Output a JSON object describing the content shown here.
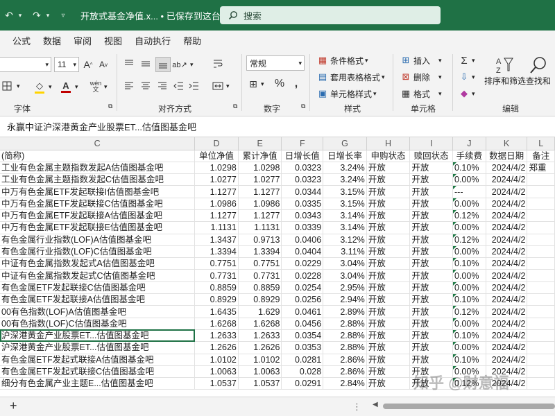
{
  "titlebar": {
    "doc_title": "开放式基金净值.x... • 已保存到这台电脑",
    "search_placeholder": "搜索"
  },
  "menu": [
    "公式",
    "数据",
    "审阅",
    "视图",
    "自动执行",
    "帮助"
  ],
  "ribbon": {
    "font_size": "11",
    "font_group": "字体",
    "align_group": "对齐方式",
    "number_format": "常规",
    "number_group": "数字",
    "cond_format": "条件格式",
    "table_format": "套用表格格式",
    "cell_style": "单元格样式",
    "style_group": "样式",
    "insert": "插入",
    "delete": "删除",
    "format": "格式",
    "cells_group": "单元格",
    "sort_filter": "排序和筛选",
    "find_select": "查找和",
    "edit_group": "编辑",
    "font_grow": "A",
    "font_shrink": "A",
    "percent": "%",
    "comma": ",",
    "wen": "wén"
  },
  "formula": {
    "content": "永赢中证沪深港黄金产业股票ET...估值图基金吧"
  },
  "columns": [
    "C",
    "D",
    "E",
    "F",
    "G",
    "H",
    "I",
    "J",
    "K",
    "L"
  ],
  "headers": [
    "(简称)",
    "单位净值",
    "累计净值",
    "日增长值",
    "日增长率",
    "申购状态",
    "赎回状态",
    "手续费",
    "数据日期",
    "备注"
  ],
  "rows": [
    {
      "name": "工业有色金属主题指数发起A估值图基金吧",
      "nav": "1.0298",
      "acc": "1.0298",
      "chg": "0.0323",
      "rate": "3.24%",
      "buy": "开放",
      "sell": "开放",
      "fee": "0.10%",
      "date": "2024/4/2",
      "note": "郑重"
    },
    {
      "name": "工业有色金属主题指数发起C估值图基金吧",
      "nav": "1.0277",
      "acc": "1.0277",
      "chg": "0.0323",
      "rate": "3.24%",
      "buy": "开放",
      "sell": "开放",
      "fee": "0.00%",
      "date": "2024/4/2",
      "note": ""
    },
    {
      "name": "中万有色金属ETF发起联接I估值图基金吧",
      "nav": "1.1277",
      "acc": "1.1277",
      "chg": "0.0344",
      "rate": "3.15%",
      "buy": "开放",
      "sell": "开放",
      "fee": "---",
      "date": "2024/4/2",
      "note": ""
    },
    {
      "name": "中万有色金属ETF发起联接C估值图基金吧",
      "nav": "1.0986",
      "acc": "1.0986",
      "chg": "0.0335",
      "rate": "3.15%",
      "buy": "开放",
      "sell": "开放",
      "fee": "0.00%",
      "date": "2024/4/2",
      "note": ""
    },
    {
      "name": "中万有色金属ETF发起联接A估值图基金吧",
      "nav": "1.1277",
      "acc": "1.1277",
      "chg": "0.0343",
      "rate": "3.14%",
      "buy": "开放",
      "sell": "开放",
      "fee": "0.12%",
      "date": "2024/4/2",
      "note": ""
    },
    {
      "name": "中万有色金属ETF发起联接E估值图基金吧",
      "nav": "1.1131",
      "acc": "1.1131",
      "chg": "0.0339",
      "rate": "3.14%",
      "buy": "开放",
      "sell": "开放",
      "fee": "0.00%",
      "date": "2024/4/2",
      "note": ""
    },
    {
      "name": "有色金属行业指数(LOF)A估值图基金吧",
      "nav": "1.3437",
      "acc": "0.9713",
      "chg": "0.0406",
      "rate": "3.12%",
      "buy": "开放",
      "sell": "开放",
      "fee": "0.12%",
      "date": "2024/4/2",
      "note": ""
    },
    {
      "name": "有色金属行业指数(LOF)C估值图基金吧",
      "nav": "1.3394",
      "acc": "1.3394",
      "chg": "0.0404",
      "rate": "3.11%",
      "buy": "开放",
      "sell": "开放",
      "fee": "0.00%",
      "date": "2024/4/2",
      "note": ""
    },
    {
      "name": "中证有色金属指数发起式A估值图基金吧",
      "nav": "0.7751",
      "acc": "0.7751",
      "chg": "0.0229",
      "rate": "3.04%",
      "buy": "开放",
      "sell": "开放",
      "fee": "0.10%",
      "date": "2024/4/2",
      "note": ""
    },
    {
      "name": "中证有色金属指数发起式C估值图基金吧",
      "nav": "0.7731",
      "acc": "0.7731",
      "chg": "0.0228",
      "rate": "3.04%",
      "buy": "开放",
      "sell": "开放",
      "fee": "0.00%",
      "date": "2024/4/2",
      "note": ""
    },
    {
      "name": "有色金属ETF发起联接C估值图基金吧",
      "nav": "0.8859",
      "acc": "0.8859",
      "chg": "0.0254",
      "rate": "2.95%",
      "buy": "开放",
      "sell": "开放",
      "fee": "0.00%",
      "date": "2024/4/2",
      "note": ""
    },
    {
      "name": "有色金属ETF发起联接A估值图基金吧",
      "nav": "0.8929",
      "acc": "0.8929",
      "chg": "0.0256",
      "rate": "2.94%",
      "buy": "开放",
      "sell": "开放",
      "fee": "0.10%",
      "date": "2024/4/2",
      "note": ""
    },
    {
      "name": "00有色指数(LOF)A估值图基金吧",
      "nav": "1.6435",
      "acc": "1.629",
      "chg": "0.0461",
      "rate": "2.89%",
      "buy": "开放",
      "sell": "开放",
      "fee": "0.12%",
      "date": "2024/4/2",
      "note": ""
    },
    {
      "name": "00有色指数(LOF)C估值图基金吧",
      "nav": "1.6268",
      "acc": "1.6268",
      "chg": "0.0456",
      "rate": "2.88%",
      "buy": "开放",
      "sell": "开放",
      "fee": "0.00%",
      "date": "2024/4/2",
      "note": ""
    },
    {
      "name": "沪深港黄金产业股票ET...估值图基金吧",
      "nav": "1.2633",
      "acc": "1.2633",
      "chg": "0.0354",
      "rate": "2.88%",
      "buy": "开放",
      "sell": "开放",
      "fee": "0.10%",
      "date": "2024/4/2",
      "note": ""
    },
    {
      "name": "沪深港黄金产业股票ET...估值图基金吧",
      "nav": "1.2626",
      "acc": "1.2626",
      "chg": "0.0353",
      "rate": "2.88%",
      "buy": "开放",
      "sell": "开放",
      "fee": "0.00%",
      "date": "2024/4/2",
      "note": ""
    },
    {
      "name": "有色金属ETF发起式联接A估值图基金吧",
      "nav": "1.0102",
      "acc": "1.0102",
      "chg": "0.0281",
      "rate": "2.86%",
      "buy": "开放",
      "sell": "开放",
      "fee": "0.10%",
      "date": "2024/4/2",
      "note": ""
    },
    {
      "name": "有色金属ETF发起式联接C估值图基金吧",
      "nav": "1.0063",
      "acc": "1.0063",
      "chg": "0.028",
      "rate": "2.86%",
      "buy": "开放",
      "sell": "开放",
      "fee": "0.00%",
      "date": "2024/4/2",
      "note": ""
    },
    {
      "name": "细分有色金属产业主题E...估值图基金吧",
      "nav": "1.0537",
      "acc": "1.0537",
      "chg": "0.0291",
      "rate": "2.84%",
      "buy": "开放",
      "sell": "开放",
      "fee": "0.12%",
      "date": "2024/4/2",
      "note": ""
    }
  ],
  "selected_row": 14,
  "watermark": "知乎 @财意福",
  "add_sheet": "+",
  "colors": {
    "titlebar": "#1f7145",
    "accent": "#1e7145",
    "font_color": "#c00000",
    "highlight": "#ffd400"
  }
}
